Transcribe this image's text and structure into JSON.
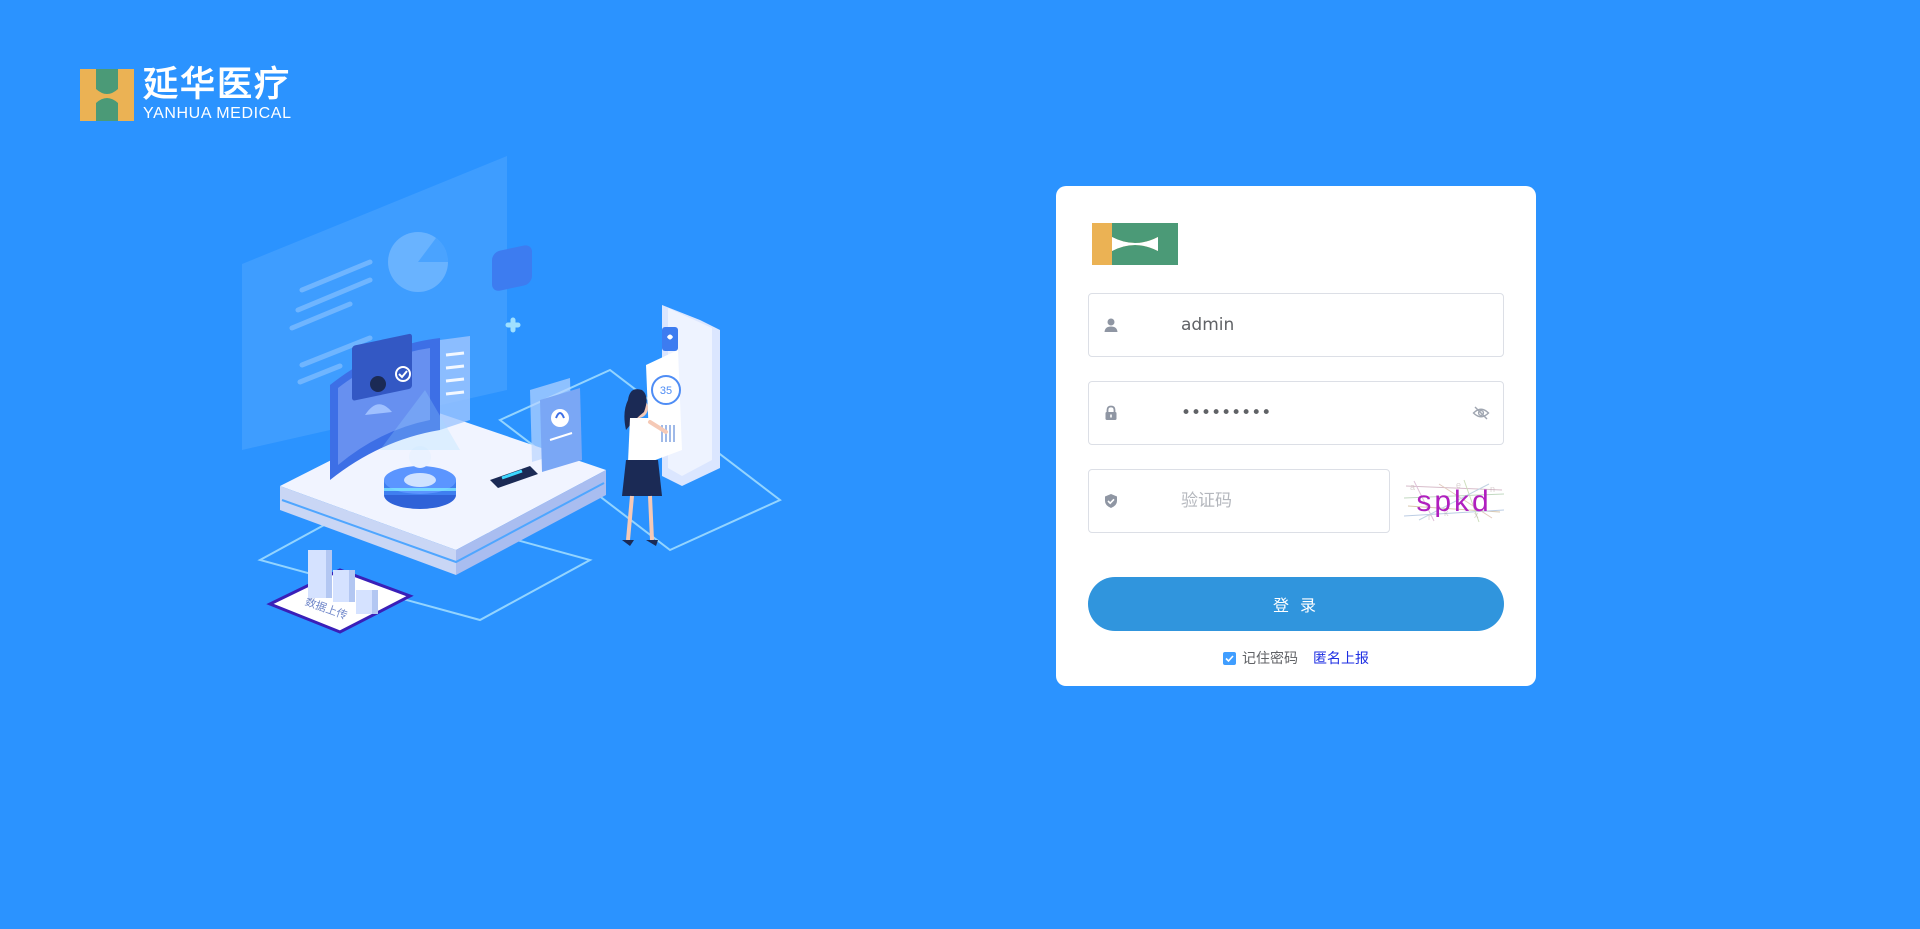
{
  "brand": {
    "name_cn": "延华医疗",
    "name_en": "YANHUA MEDICAL"
  },
  "illustration": {
    "caption": "数据上传",
    "phone_number": "35"
  },
  "login": {
    "username": {
      "value": "admin",
      "icon": "user-icon"
    },
    "password": {
      "value": "•••••••••",
      "icon": "lock-icon",
      "toggle_icon": "eye-off-icon"
    },
    "captcha": {
      "placeholder": "验证码",
      "icon": "shield-check-icon",
      "image_text": "spkd"
    },
    "submit_label": "登 录",
    "remember_checked": true,
    "remember_label": "记住密码",
    "anon_report_label": "匿名上报"
  },
  "colors": {
    "background": "#2b93ff",
    "button": "#3095dd",
    "link": "#1d2ee3",
    "checkbox": "#409eff",
    "logo_yellow": "#ebb254",
    "logo_green": "#4b9a77"
  }
}
